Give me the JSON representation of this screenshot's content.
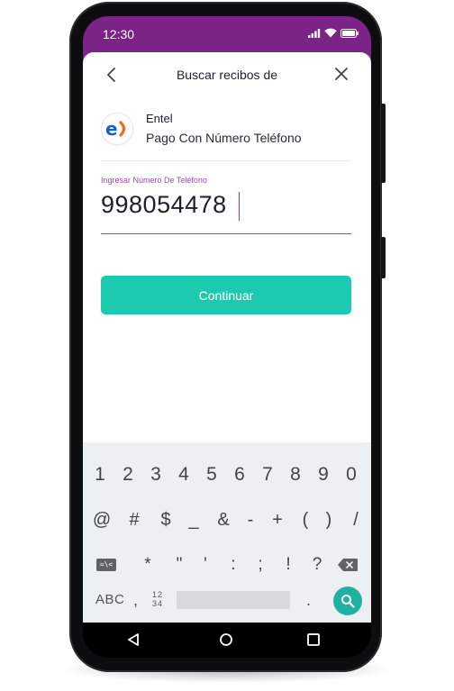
{
  "status": {
    "time": "12:30"
  },
  "header": {
    "title": "Buscar recibos de"
  },
  "biller": {
    "name": "Entel",
    "subtitle": "Pago Con Número Teléfono",
    "logo_text": "e"
  },
  "field": {
    "label": "Ingresar Número De Teléfono",
    "value": "998054478"
  },
  "actions": {
    "continue_label": "Continuar"
  },
  "keyboard": {
    "row1": [
      "1",
      "2",
      "3",
      "4",
      "5",
      "6",
      "7",
      "8",
      "9",
      "0"
    ],
    "row2": [
      "@",
      "#",
      "$",
      "_",
      "&",
      "-",
      "+",
      "(",
      ")",
      "/"
    ],
    "row3": [
      "*",
      "\"",
      "'",
      ":",
      ";",
      "!",
      "?"
    ],
    "sym_switch": "=\\<",
    "abc_label": "ABC",
    "comma": ",",
    "num_layout_top": "12",
    "num_layout_bottom": "34",
    "period": "."
  },
  "colors": {
    "brand_purple": "#7b2386",
    "accent_teal": "#1ccaaf",
    "entel_blue": "#1660c7",
    "entel_orange": "#ef6c1a"
  },
  "icons": {
    "back": "chevron-left-icon",
    "close": "close-icon",
    "signal": "signal-icon",
    "wifi": "wifi-icon",
    "battery": "battery-icon",
    "search": "search-icon",
    "delete": "backspace-icon",
    "nav_back": "triangle-back-icon",
    "nav_home": "circle-home-icon",
    "nav_recents": "square-recents-icon"
  }
}
